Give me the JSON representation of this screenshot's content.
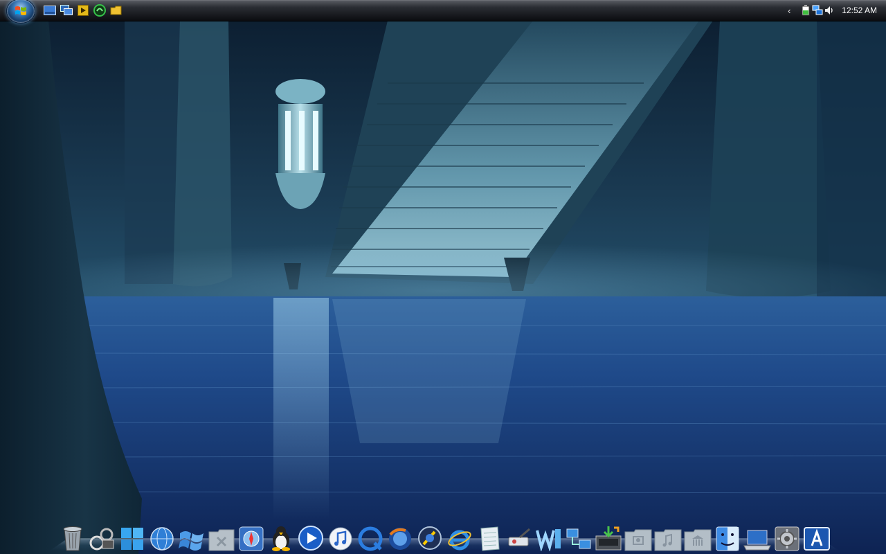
{
  "desktop": {
    "wallpaper": "underwater-temple-stairs",
    "colors": {
      "accent": "#2f6fb0",
      "water": "#1a3d79",
      "stone": "#5d8fa6"
    }
  },
  "taskbar": {
    "start_button": "windows-start-orb",
    "quick_launch": [
      "show-desktop-icon",
      "switch-windows-icon",
      "media-icon",
      "green-gauge-icon",
      "yellow-folder-icon"
    ],
    "tray_icons": [
      "battery-icon",
      "network-icon",
      "volume-icon"
    ],
    "tray_expand": "‹",
    "clock": "12:52 AM"
  },
  "dock": {
    "items": [
      "trash-icon",
      "linkage-icon",
      "windows-flag-icon",
      "globe-network-icon",
      "windows-wave-icon",
      "applications-folder-icon",
      "safari-tile-icon",
      "tux-penguin-icon",
      "media-player-icon",
      "itunes-icon",
      "quicktime-icon",
      "firefox-globe-icon",
      "aim-icon",
      "internet-explorer-icon",
      "notepad-icon",
      "soldering-icon",
      "word-icon",
      "network-share-icon",
      "downloads-tray-icon",
      "pictures-folder-icon",
      "music-folder-icon",
      "library-folder-icon",
      "finder-icon",
      "laptop-icon",
      "system-preferences-icon",
      "app-store-icon"
    ]
  }
}
